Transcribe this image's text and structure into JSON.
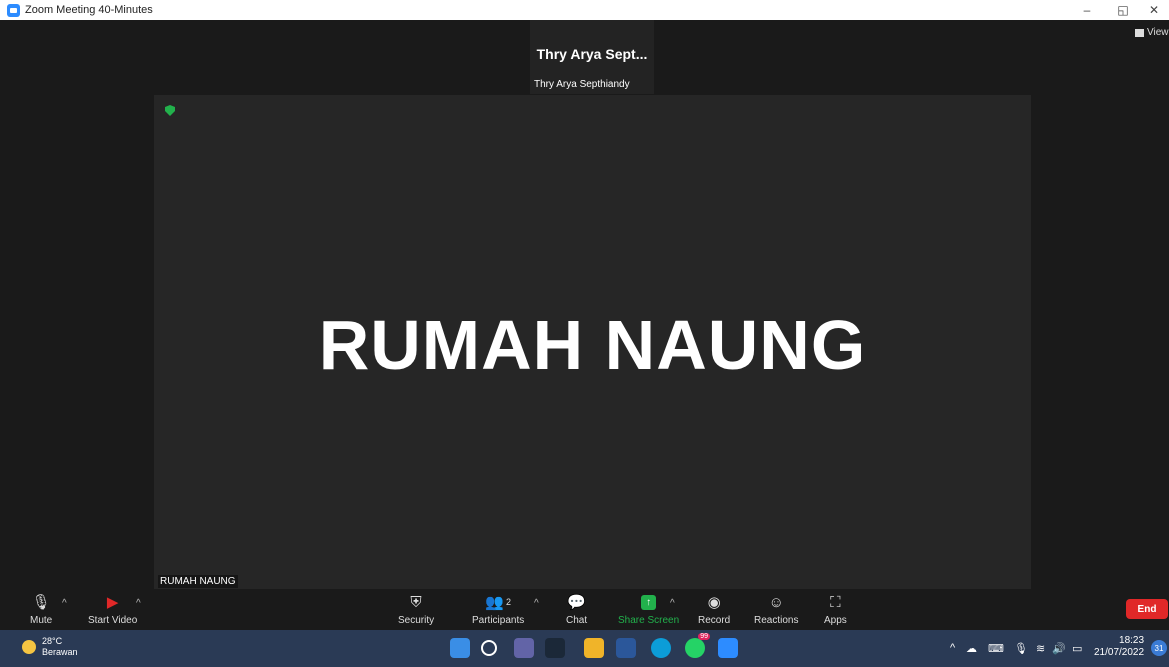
{
  "window": {
    "title": "Zoom Meeting 40-Minutes",
    "minimize": "–",
    "restore": "◱",
    "close": "✕"
  },
  "view_label": "View",
  "thumbnail": {
    "display_name": "Thry Arya Sept...",
    "full_name": "Thry Arya Septhiandy"
  },
  "stage": {
    "shared_text": "RUMAH NAUNG",
    "label": "RUMAH NAUNG"
  },
  "toolbar": {
    "mute": "Mute",
    "start_video": "Start Video",
    "security": "Security",
    "participants": "Participants",
    "participants_count": "2",
    "chat": "Chat",
    "share_screen": "Share Screen",
    "record": "Record",
    "reactions": "Reactions",
    "apps": "Apps",
    "end": "End"
  },
  "taskbar": {
    "temperature": "28°C",
    "weather": "Berawan",
    "whatsapp_badge": "99",
    "time": "18:23",
    "date": "21/07/2022",
    "notifications": "31"
  },
  "colors": {
    "share_green": "#22b14c",
    "end_red": "#e02828",
    "zoom_blue": "#2d8cff"
  }
}
